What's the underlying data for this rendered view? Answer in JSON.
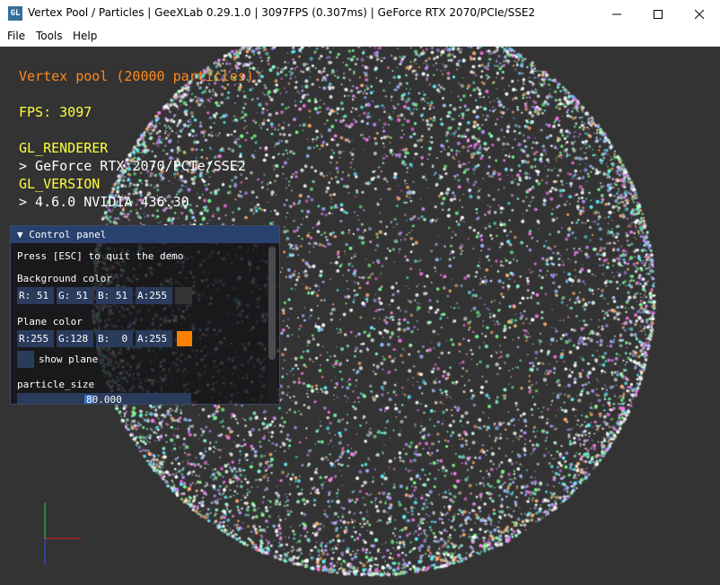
{
  "window": {
    "icon_text": "GL",
    "title": "Vertex Pool / Particles | GeeXLab 0.29.1.0 | 3097FPS (0.307ms) | GeForce RTX 2070/PCIe/SSE2",
    "controls": {
      "minimize": "minimize-icon",
      "maximize": "maximize-icon",
      "close": "close-icon"
    }
  },
  "menu": [
    "File",
    "Tools",
    "Help"
  ],
  "hud": {
    "heading": "Vertex pool (20000 particles)",
    "fps": "FPS: 3097",
    "renderer_label": "GL_RENDERER",
    "renderer_value": "> GeForce RTX 2070/PCIe/SSE2",
    "version_label": "GL_VERSION",
    "version_value": "> 4.6.0 NVIDIA 436.30"
  },
  "panel": {
    "title": "▼ Control panel",
    "quit_hint": "Press [ESC] to quit the demo",
    "background_color": {
      "label": "Background color",
      "r": "R: 51",
      "g": "G: 51",
      "b": "B: 51",
      "a": "A:255",
      "swatch": "#333333"
    },
    "plane_color": {
      "label": "Plane color",
      "r": "R:255",
      "g": "G:128",
      "b": "B:  0",
      "a": "A:255",
      "swatch": "#ff8000"
    },
    "show_plane": {
      "label": "show plane",
      "checked": false
    },
    "particle_size": {
      "label": "particle_size",
      "value": "80.000"
    }
  },
  "colors": {
    "background": "#333333",
    "hud_orange": "#ff8a1e",
    "hud_yellow": "#ffff3c",
    "panel_header": "#29416e",
    "widget": "#2a3b5c"
  },
  "scene": {
    "particle_count": 20000,
    "shape": "sphere"
  }
}
